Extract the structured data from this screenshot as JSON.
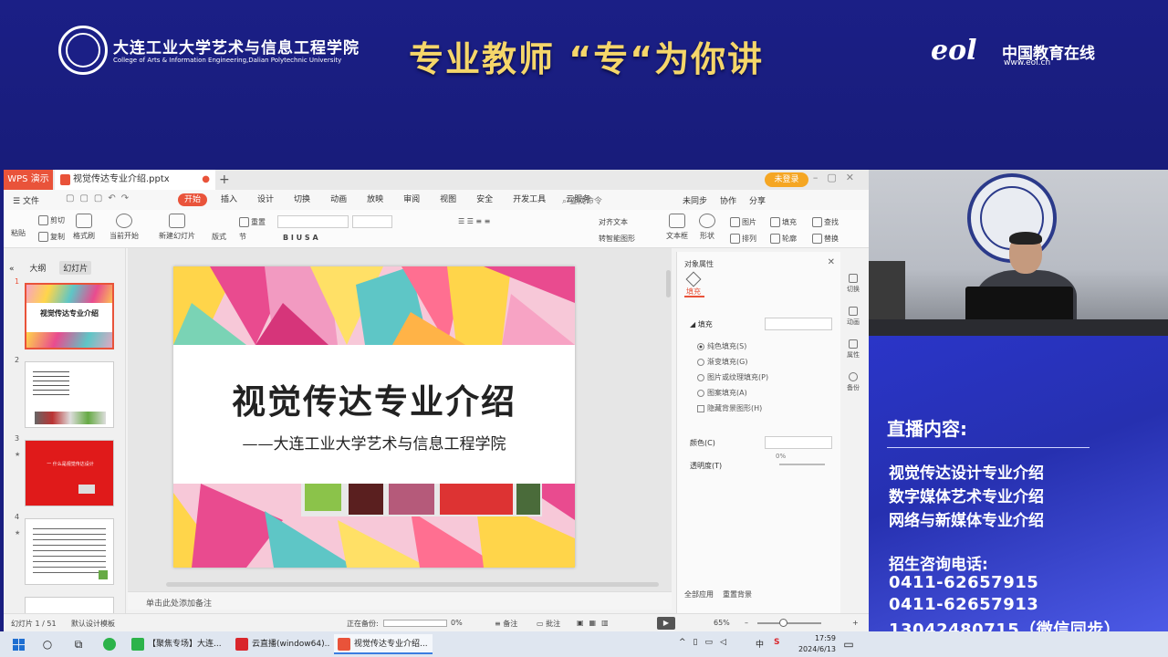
{
  "banner": {
    "school_name": "大连工业大学艺术与信息工程学院",
    "school_name_en": "College of Arts & Information Engineering,Dalian Polytechnic University",
    "slogan": "专业教师 “专“为你讲",
    "partner_mark": "eol",
    "partner_name": "中国教育在线",
    "partner_url": "www.eol.cn"
  },
  "wps": {
    "app_tab": "WPS 演示",
    "doc_tab": "视觉传达专业介绍.pptx",
    "login_label": "未登录",
    "menu": {
      "file": "文件",
      "tabs": [
        "开始",
        "插入",
        "设计",
        "切换",
        "动画",
        "放映",
        "审阅",
        "视图",
        "安全",
        "开发工具",
        "云服务"
      ],
      "active_tab": "开始",
      "search_placeholder": "查找命令",
      "right_actions": [
        "未同步",
        "协作",
        "分享"
      ]
    },
    "ribbon": {
      "paste": "粘贴",
      "cut": "剪切",
      "copy": "复制",
      "format_painter": "格式刷",
      "from_current": "当前开始",
      "new_slide": "新建幻灯片",
      "layout": "版式",
      "section": "节",
      "reset": "重置",
      "text_box": "文本框",
      "shape": "形状",
      "picture": "图片",
      "arrange": "排列",
      "fill": "填充",
      "outline": "轮廓",
      "find": "查找",
      "replace": "替换",
      "align_text": "对齐文本",
      "smartart": "转智能图形"
    },
    "left_panel": {
      "tabs": [
        "大纲",
        "幻灯片"
      ],
      "active_tab": "幻灯片",
      "slide_numbers": [
        "1",
        "2",
        "3",
        "4"
      ],
      "thumb1_title": "视觉传达专业介绍",
      "thumb3_title": "一 什么是视觉传达设计"
    },
    "slide": {
      "title": "视觉传达专业介绍",
      "subtitle": "——大连工业大学艺术与信息工程学院"
    },
    "notes_placeholder": "单击此处添加备注",
    "properties": {
      "header": "对象属性",
      "fill_tab": "填充",
      "fill_section": "填充",
      "options": [
        "纯色填充(S)",
        "渐变填充(G)",
        "图片或纹理填充(P)",
        "图案填充(A)"
      ],
      "selected_option": "纯色填充(S)",
      "hide_bg": "隐藏背景图形(H)",
      "color_label": "颜色(C)",
      "transparency_label": "透明度(T)",
      "transparency_value": "0%",
      "apply_all": "全部应用",
      "reset_bg": "重置背景"
    },
    "side_tools": [
      "切换",
      "动画",
      "属性",
      "备份"
    ],
    "status": {
      "slide_count": "幻灯片 1 / 51",
      "template": "默认设计模板",
      "backup": "正在备份:",
      "backup_pct": "0%",
      "notes": "备注",
      "comments": "批注",
      "zoom": "65%"
    }
  },
  "info": {
    "title": "直播内容:",
    "lines": [
      "视觉传达设计专业介绍",
      "数字媒体艺术专业介绍",
      "网络与新媒体专业介绍"
    ],
    "hotline_label": "招生咨询电话:",
    "phones": [
      "0411-62657915",
      "0411-62657913",
      "13042480715（微信同步）"
    ]
  },
  "taskbar": {
    "apps": [
      "【聚焦专场】大连...",
      "云直播(window64)...",
      "视觉传达专业介绍..."
    ],
    "active_app": "视觉传达专业介绍...",
    "ime": "中",
    "time": "17:59",
    "date": "2024/6/13"
  },
  "colors": {
    "banner_bg": "#1b1f86",
    "slogan": "#f5d66a",
    "wps_accent": "#e9533a",
    "info_bg": "#2a35c8"
  }
}
